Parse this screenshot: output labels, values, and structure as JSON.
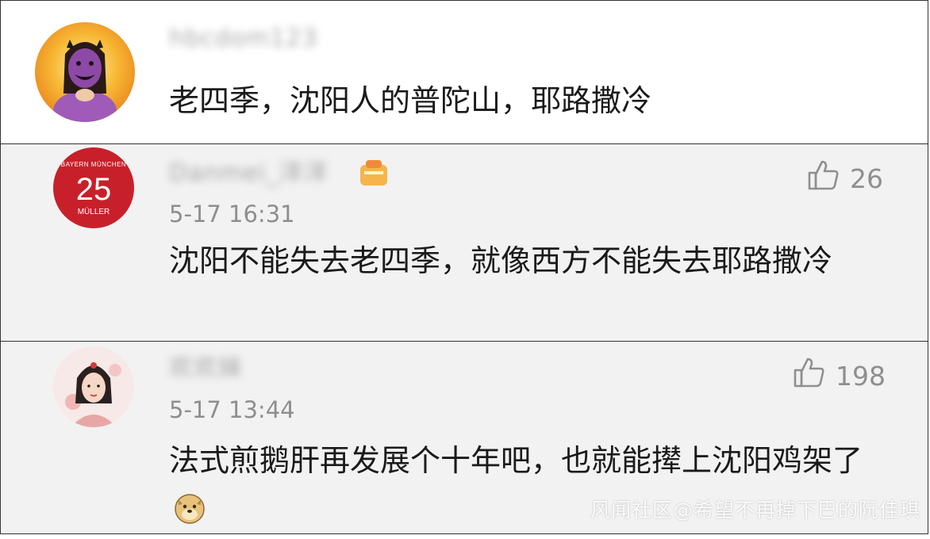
{
  "comments": [
    {
      "username": "hbcdom123",
      "text": "老四季，沈阳人的普陀山，耶路撒冷"
    },
    {
      "username": "Danmei_洋洋",
      "timestamp": "5-17 16:31",
      "likes": "26",
      "text": "沈阳不能失去老四季，就像西方不能失去耶路撒冷"
    },
    {
      "username": "欢欢妹",
      "timestamp": "5-17 13:44",
      "likes": "198",
      "text": "法式煎鹅肝再发展个十年吧，也就能撵上沈阳鸡架了"
    }
  ],
  "avatar_badge": {
    "top": "BAYERN MÜNCHEN",
    "number": "25",
    "bottom": "MÜLLER"
  },
  "watermark": "风闻社区@希望不再掉下巴的阮佳琪",
  "colors": {
    "badge_red": "#c8202b",
    "like_gray": "#8f8f8f",
    "row_bg": "#f2f2f2"
  }
}
